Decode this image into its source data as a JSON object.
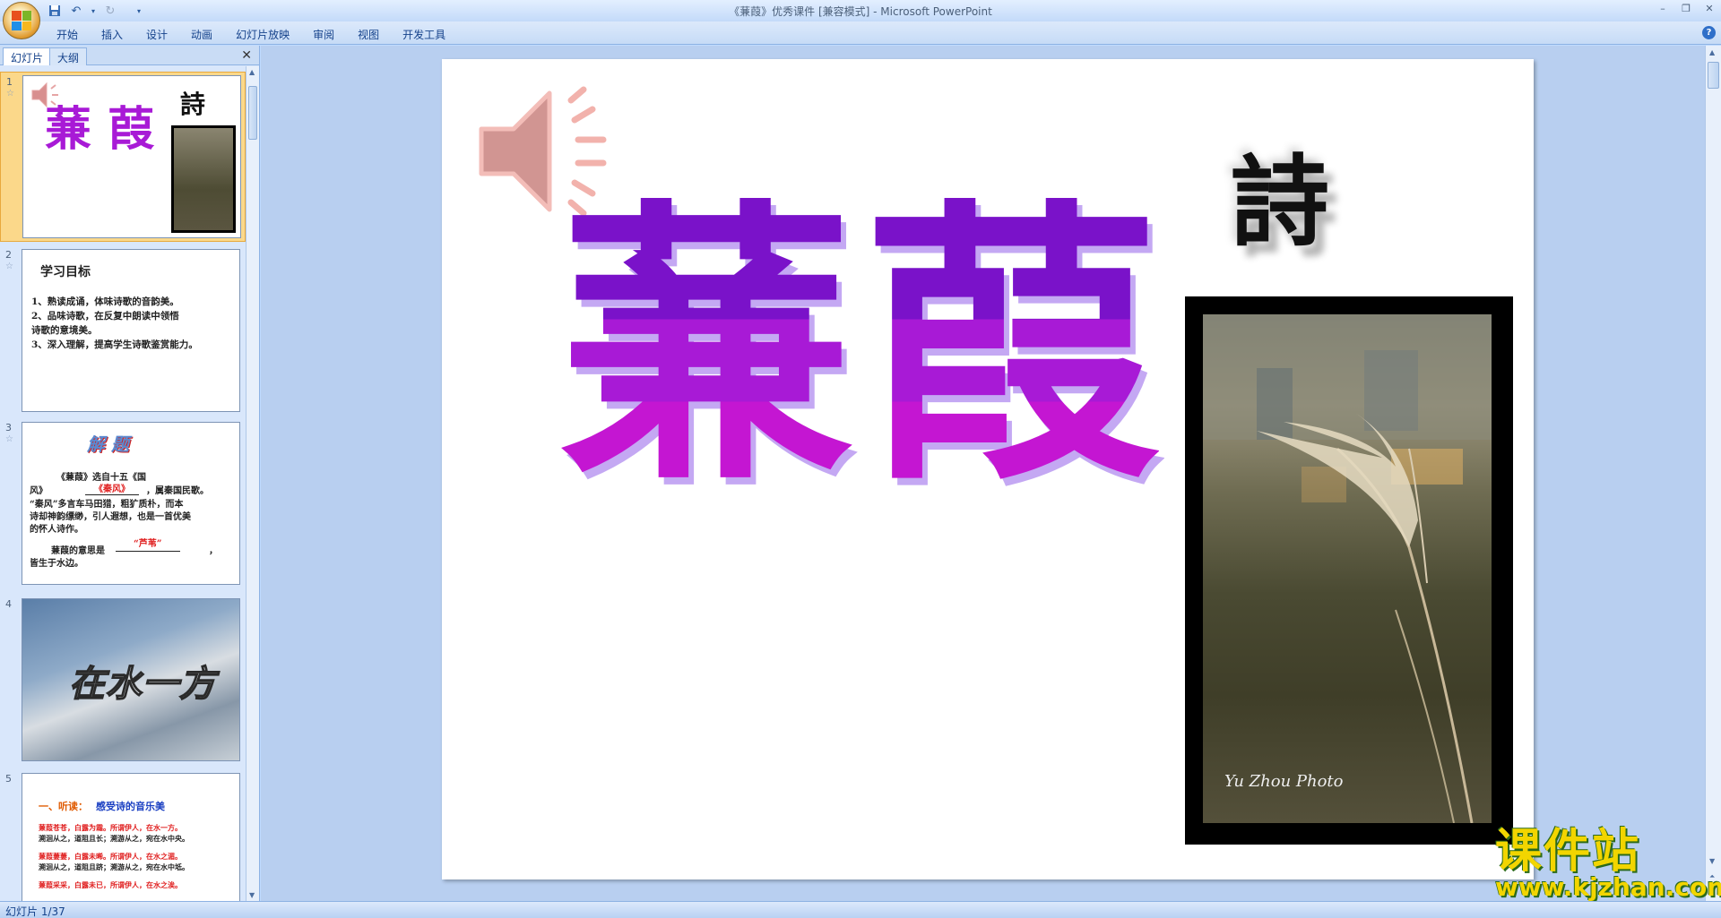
{
  "window": {
    "title": "《蒹葭》优秀课件 [兼容模式] - Microsoft PowerPoint"
  },
  "ribbon": {
    "tabs": [
      "开始",
      "插入",
      "设计",
      "动画",
      "幻灯片放映",
      "审阅",
      "视图",
      "开发工具"
    ]
  },
  "left_pane": {
    "tab_slides": "幻灯片",
    "tab_outline": "大纲",
    "slides": [
      {
        "number": "1",
        "title": "蒹 葭",
        "corner": "詩"
      },
      {
        "number": "2",
        "heading": "学习目标",
        "lines": [
          "1、熟读成诵，体味诗歌的音韵美。",
          "2、品味诗歌，在反复中朗读中领悟",
          "诗歌的意境美。",
          "3、深入理解，提高学生诗歌鉴赏能力。"
        ]
      },
      {
        "number": "3",
        "heading": "解 题",
        "lines": [
          "《蒹葭》选自十五《国",
          "风》",
          "《秦风》",
          "，属秦国民歌。",
          "“秦风”多言车马田猎，粗犷质朴，而本",
          "诗却神韵缥缈，引人遐想，也是一首优美",
          "的怀人诗作。",
          "蒹葭的意思是",
          "“芦苇”",
          "，",
          "皆生于水边。"
        ]
      },
      {
        "number": "4",
        "title": "在水一方"
      },
      {
        "number": "5",
        "heading_prefix": "一、听读：",
        "heading": "感受诗的音乐美",
        "lines": [
          "蒹葭苍苍，白露为霜。所谓伊人，在水一方。",
          "溯洄从之，道阻且长；溯游从之，宛在水中央。",
          "蒹葭萋萋，白露未晞。所谓伊人，在水之湄。",
          "溯洄从之，道阻且跻；溯游从之，宛在水中坻。",
          "蒹葭采采，白露未已，所谓伊人，在水之涘。"
        ]
      }
    ]
  },
  "slide": {
    "title_char1": "蒹",
    "title_char2": "葭",
    "corner_char": "詩",
    "photo_caption": "Yu Zhou Photo"
  },
  "watermark": {
    "brand": "课件站",
    "url": "www.kjzhan.com"
  },
  "status": {
    "slide_counter": "幻灯片 1/37"
  },
  "colors": {
    "title_purple_top": "#7a12c9",
    "title_purple_mid": "#a81ad6",
    "title_purple_bottom": "#c416d2",
    "selection": "#fbd88a",
    "ribbon": "#c6dbf6"
  }
}
